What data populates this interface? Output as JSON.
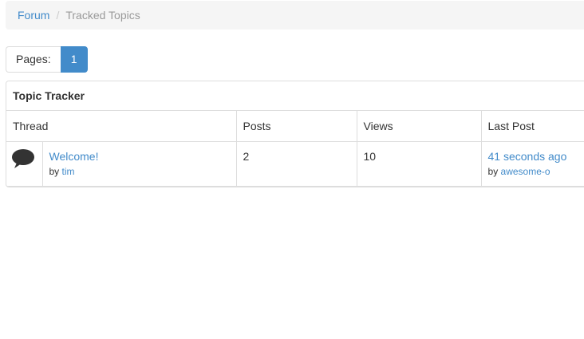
{
  "breadcrumb": {
    "home": "Forum",
    "separator": "/",
    "current": "Tracked Topics"
  },
  "pager": {
    "label": "Pages:",
    "current_page": "1"
  },
  "panel": {
    "title": "Topic Tracker"
  },
  "table": {
    "headers": {
      "thread": "Thread",
      "posts": "Posts",
      "views": "Views",
      "last_post": "Last Post"
    },
    "rows": [
      {
        "icon": "speech-bubble-icon",
        "title": "Welcome!",
        "by_label": "by",
        "author": "tim",
        "posts": "2",
        "views": "10",
        "last_post_time": "41 seconds ago",
        "last_post_by_label": "by",
        "last_post_author": "awesome-o"
      }
    ]
  },
  "colors": {
    "link": "#428bca",
    "active_page_bg": "#428bca",
    "breadcrumb_bg": "#f5f5f5",
    "border": "#dddddd"
  }
}
